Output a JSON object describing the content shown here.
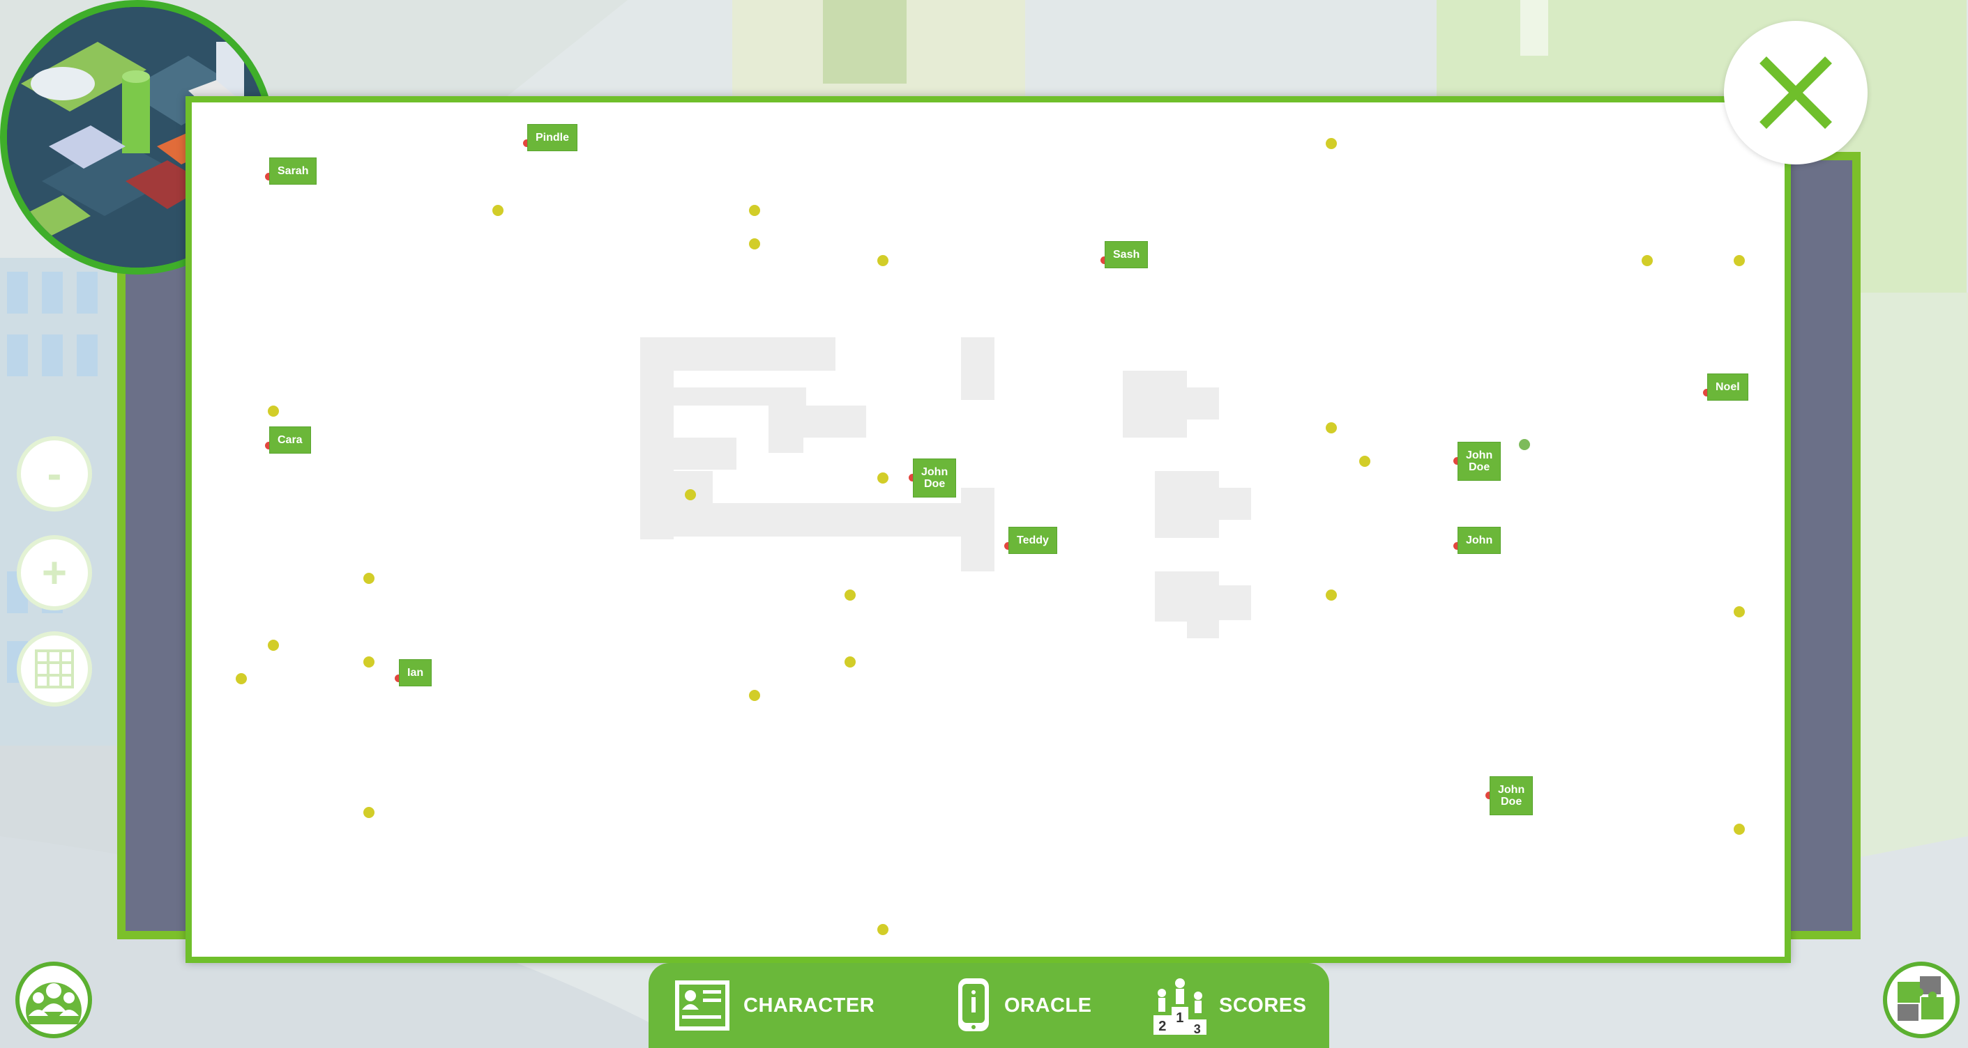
{
  "controls": {
    "zoom_out_label": "-",
    "zoom_in_label": "+"
  },
  "tabs": [
    {
      "label": "CHARACTER",
      "icon": "character-card-icon"
    },
    {
      "label": "ORACLE",
      "icon": "oracle-phone-icon"
    },
    {
      "label": "SCORES",
      "icon": "podium-icon"
    }
  ],
  "map": {
    "players": [
      {
        "name": "Pindle"
      },
      {
        "name": "Sarah"
      },
      {
        "name": "Sash"
      },
      {
        "name": "Noel"
      },
      {
        "name": "Cara"
      },
      {
        "name": "John\nDoe"
      },
      {
        "name": "John\nDoe"
      },
      {
        "name": "Teddy"
      },
      {
        "name": "John"
      },
      {
        "name": "Ian"
      },
      {
        "name": "John\nDoe"
      }
    ]
  },
  "colors": {
    "accent_green": "#6fbf2b",
    "item_dot": "#d2cd28",
    "player_pin": "#e2463e",
    "panel_dark": "#6b7088"
  },
  "icons": {
    "close": "close-icon",
    "team": "team-icon",
    "puzzle": "puzzle-icon",
    "grid": "grid-icon"
  }
}
